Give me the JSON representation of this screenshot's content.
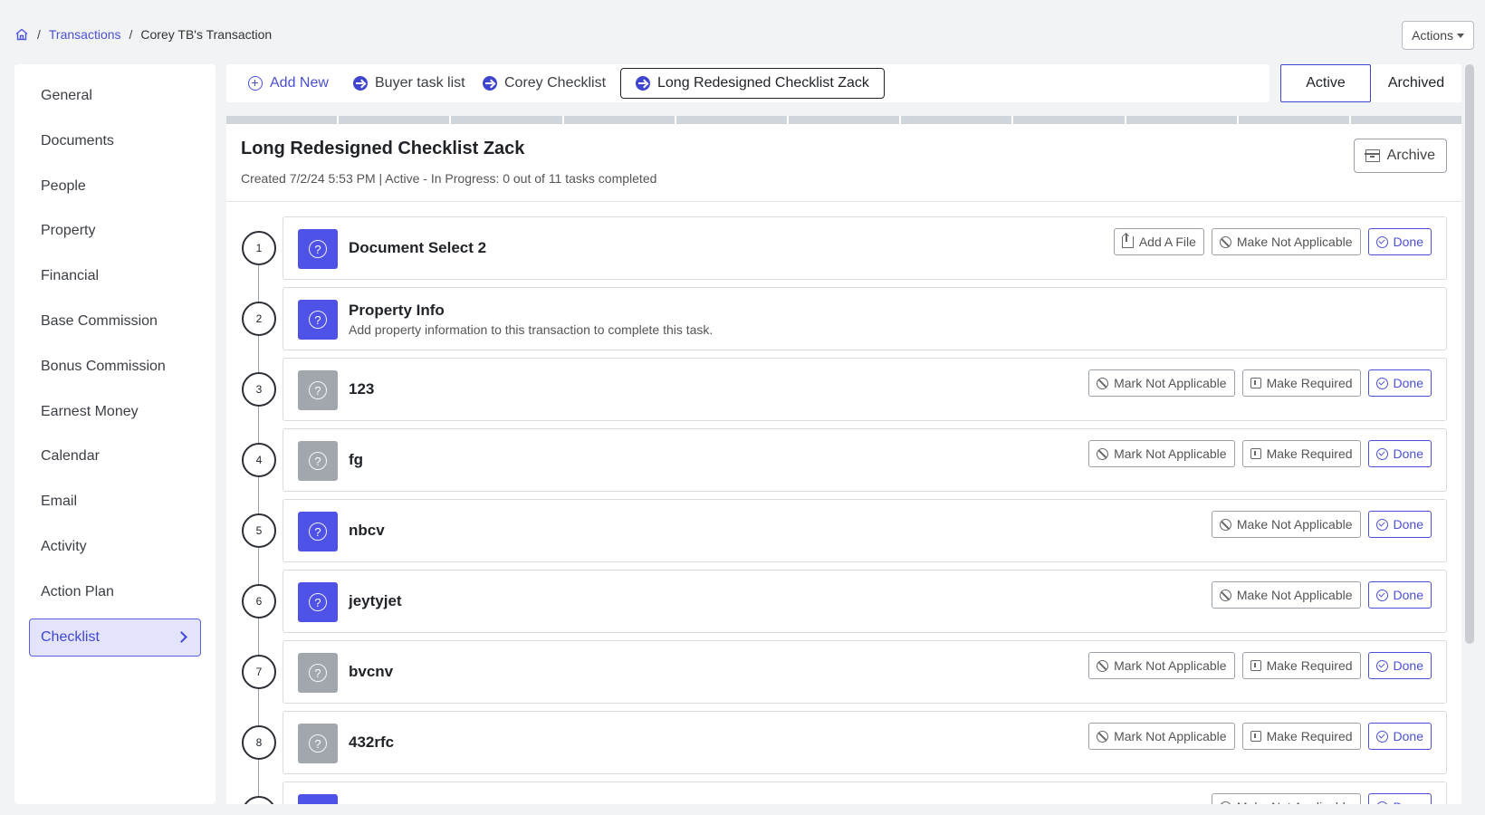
{
  "breadcrumb": {
    "transactions": "Transactions",
    "current": "Corey TB's Transaction",
    "sep": "/"
  },
  "actions_label": "Actions",
  "sidebar": {
    "items": [
      {
        "label": "General"
      },
      {
        "label": "Documents"
      },
      {
        "label": "People"
      },
      {
        "label": "Property"
      },
      {
        "label": "Financial"
      },
      {
        "label": "Base Commission"
      },
      {
        "label": "Bonus Commission"
      },
      {
        "label": "Earnest Money"
      },
      {
        "label": "Calendar"
      },
      {
        "label": "Email"
      },
      {
        "label": "Activity"
      },
      {
        "label": "Action Plan"
      },
      {
        "label": "Checklist",
        "active": true
      }
    ]
  },
  "tabs": {
    "add_new": "Add New",
    "items": [
      "Buyer task list",
      "Corey Checklist",
      "Long Redesigned Checklist Zack"
    ]
  },
  "status_toggle": {
    "active": "Active",
    "archived": "Archived"
  },
  "checklist": {
    "title": "Long Redesigned Checklist Zack",
    "meta": "Created 7/2/24 5:53 PM  |  Active - In Progress: 0 out of 11 tasks completed",
    "archive_label": "Archive",
    "progress_segments": 11,
    "tasks": [
      {
        "num": "1",
        "title": "Document Select 2",
        "required": true,
        "buttons": [
          "Add A File",
          "Make Not Applicable",
          "Done"
        ]
      },
      {
        "num": "2",
        "title": "Property Info",
        "desc": "Add property information to this transaction to complete this task.",
        "required": true,
        "buttons": []
      },
      {
        "num": "3",
        "title": "123",
        "required": false,
        "buttons": [
          "Mark Not Applicable",
          "Make Required",
          "Done"
        ]
      },
      {
        "num": "4",
        "title": "fg",
        "required": false,
        "buttons": [
          "Mark Not Applicable",
          "Make Required",
          "Done"
        ]
      },
      {
        "num": "5",
        "title": "nbcv",
        "required": true,
        "buttons": [
          "Make Not Applicable",
          "Done"
        ]
      },
      {
        "num": "6",
        "title": "jeytyjet",
        "required": true,
        "buttons": [
          "Make Not Applicable",
          "Done"
        ]
      },
      {
        "num": "7",
        "title": "bvcnv",
        "required": false,
        "buttons": [
          "Mark Not Applicable",
          "Make Required",
          "Done"
        ]
      },
      {
        "num": "8",
        "title": "432rfc",
        "required": false,
        "buttons": [
          "Mark Not Applicable",
          "Make Required",
          "Done"
        ]
      },
      {
        "num": "",
        "title": "",
        "required": true,
        "buttons": [
          "Make Not Applicable",
          "Done"
        ]
      }
    ]
  },
  "colors": {
    "accent": "#4f52e6",
    "inactive_icon": "#a2a6ad",
    "link": "#4b50d8"
  }
}
